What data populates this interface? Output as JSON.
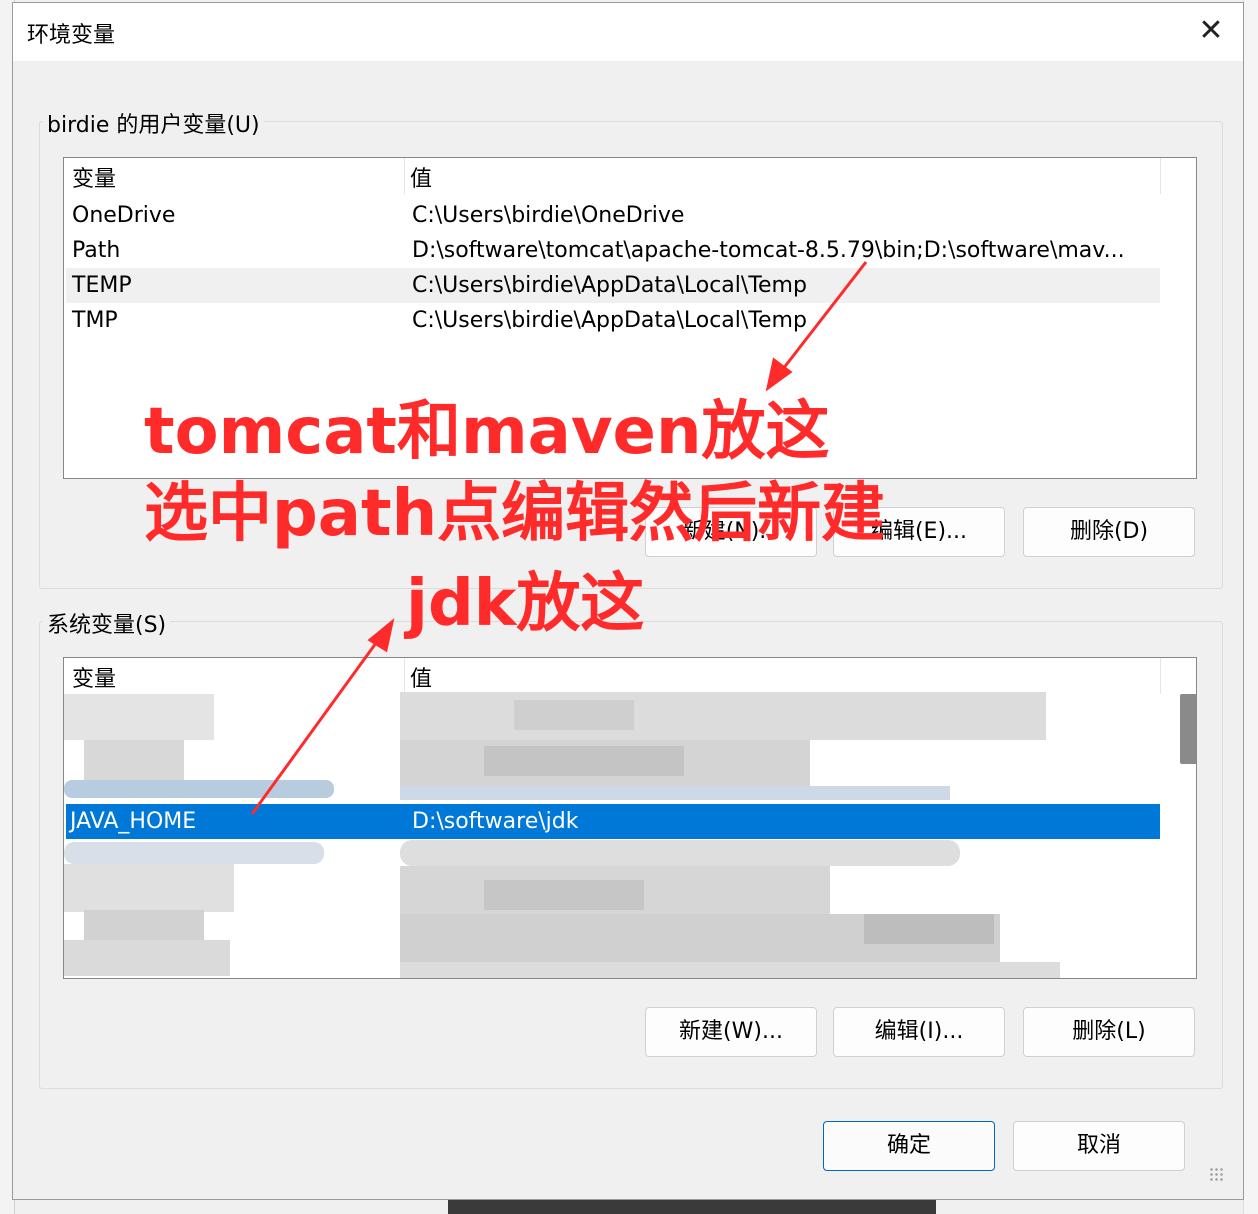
{
  "window": {
    "title": "环境变量",
    "close_icon": "close-icon"
  },
  "user_vars": {
    "label": "birdie 的用户变量(U)",
    "columns": [
      "变量",
      "值"
    ],
    "rows": [
      {
        "name": "OneDrive",
        "value": "C:\\Users\\birdie\\OneDrive"
      },
      {
        "name": "Path",
        "value": "D:\\software\\tomcat\\apache-tomcat-8.5.79\\bin;D:\\software\\mav..."
      },
      {
        "name": "TEMP",
        "value": "C:\\Users\\birdie\\AppData\\Local\\Temp"
      },
      {
        "name": "TMP",
        "value": "C:\\Users\\birdie\\AppData\\Local\\Temp"
      }
    ],
    "buttons": {
      "new": "新建(N)...",
      "edit": "编辑(E)...",
      "delete": "删除(D)"
    }
  },
  "system_vars": {
    "label": "系统变量(S)",
    "columns": [
      "变量",
      "值"
    ],
    "selected_row": {
      "name": "JAVA_HOME",
      "value": "D:\\software\\jdk"
    },
    "buttons": {
      "new": "新建(W)...",
      "edit": "编辑(I)...",
      "delete": "删除(L)"
    }
  },
  "footer": {
    "ok": "确定",
    "cancel": "取消"
  },
  "annotations": {
    "line1": "tomcat和maven放这",
    "line2": "选中path点编辑然后新建",
    "line3": "jdk放这"
  },
  "colors": {
    "selection": "#0078d7",
    "annotation": "#ff2a2a"
  }
}
